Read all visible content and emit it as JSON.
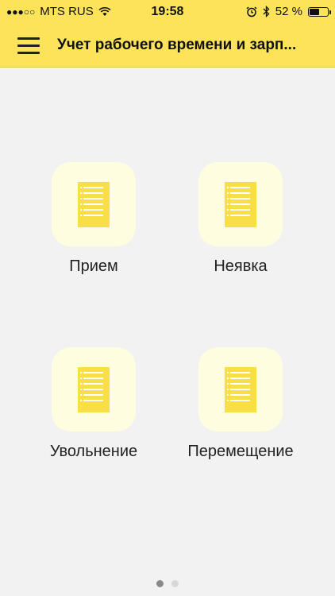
{
  "status_bar": {
    "signal_dots": "●●●○○",
    "carrier": "MTS RUS",
    "time": "19:58",
    "battery_percent": "52 %",
    "battery_level": 0.52,
    "icons": [
      "wifi-icon",
      "alarm-icon",
      "bluetooth-icon",
      "battery-icon"
    ]
  },
  "appbar": {
    "title": "Учет рабочего времени и зарп...",
    "background": "#fde35a",
    "menu_icon": "hamburger-menu-icon"
  },
  "tiles": [
    {
      "label": "Прием",
      "icon": "document-icon"
    },
    {
      "label": "Неявка",
      "icon": "document-icon"
    },
    {
      "label": "Увольнение",
      "icon": "document-icon"
    },
    {
      "label": "Перемещение",
      "icon": "document-icon"
    }
  ],
  "pager": {
    "current": 1,
    "total": 2
  },
  "colors": {
    "accent": "#fde35a",
    "icon_bg": "#fffde0",
    "icon_fg": "#f7df45",
    "background": "#f2f2f2"
  }
}
